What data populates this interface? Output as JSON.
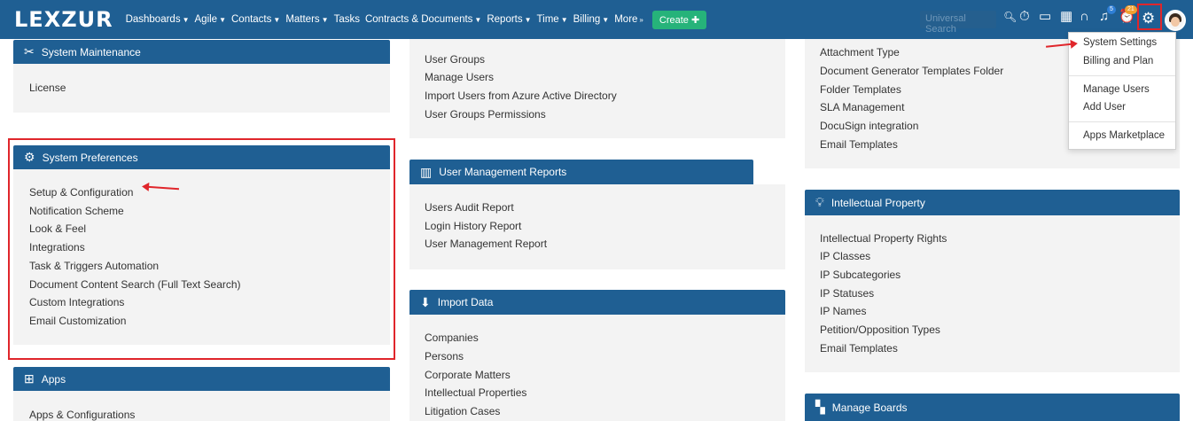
{
  "nav": {
    "logo": "LEXZUR",
    "items": [
      "Dashboards",
      "Agile",
      "Contacts",
      "Matters",
      "Tasks",
      "Contracts & Documents",
      "Reports",
      "Time",
      "Billing",
      "More"
    ],
    "create": "Create",
    "search_placeholder": "Universal Search",
    "badges": {
      "notif": "5",
      "reminders": "21"
    }
  },
  "system_maintenance": {
    "title": "System Maintenance",
    "links": [
      "License"
    ]
  },
  "system_preferences": {
    "title": "System Preferences",
    "links": [
      "Setup & Configuration",
      "Notification Scheme",
      "Look & Feel",
      "Integrations",
      "Task & Triggers Automation",
      "Document Content Search (Full Text Search)",
      "Custom Integrations",
      "Email Customization"
    ]
  },
  "apps": {
    "title": "Apps",
    "links": [
      "Apps & Configurations"
    ]
  },
  "user_links": [
    "User Groups",
    "Manage Users",
    "Import Users from Azure Active Directory",
    "User Groups Permissions"
  ],
  "user_mgmt_reports": {
    "title": "User Management Reports",
    "links": [
      "Users Audit Report",
      "Login History Report",
      "User Management Report"
    ]
  },
  "import_data": {
    "title": "Import Data",
    "links": [
      "Companies",
      "Persons",
      "Corporate Matters",
      "Intellectual Properties",
      "Litigation Cases"
    ]
  },
  "right_top_links": [
    "Attachment Type",
    "Document Generator Templates Folder",
    "Folder Templates",
    "SLA Management",
    "DocuSign integration",
    "Email Templates"
  ],
  "intellectual_property": {
    "title": "Intellectual Property",
    "links": [
      "Intellectual Property Rights",
      "IP Classes",
      "IP Subcategories",
      "IP Statuses",
      "IP Names",
      "Petition/Opposition Types",
      "Email Templates"
    ]
  },
  "manage_boards": {
    "title": "Manage Boards"
  },
  "dropdown": {
    "items": [
      "System Settings",
      "Billing and Plan",
      "Manage Users",
      "Add User",
      "Apps Marketplace"
    ]
  }
}
